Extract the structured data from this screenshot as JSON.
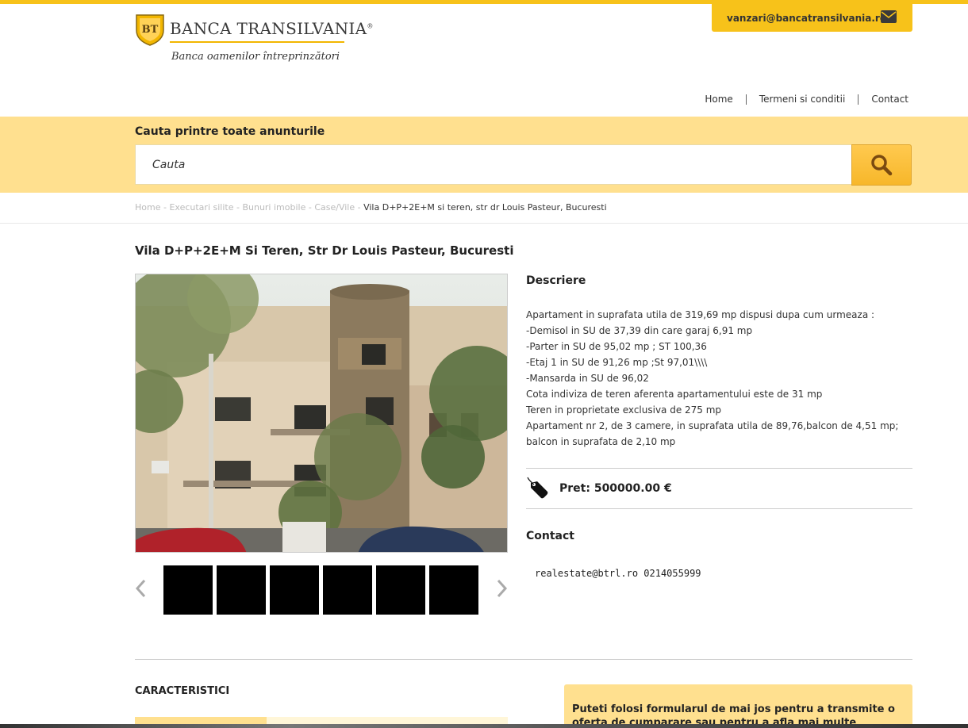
{
  "header": {
    "logo_initials": "BT",
    "bank_name": "BANCA TRANSILVANIA",
    "registered_mark": "®",
    "tagline": "Banca oamenilor întreprinzători",
    "email": "vanzari@bancatransilvania.ro"
  },
  "nav": {
    "items": [
      "Home",
      "Termeni si conditii",
      "Contact"
    ]
  },
  "search": {
    "title": "Cauta printre toate anunturile",
    "placeholder": "Cauta"
  },
  "breadcrumb": {
    "items": [
      "Home",
      "Executari silite",
      "Bunuri imobile",
      "Case/Vile"
    ],
    "separator": " - ",
    "current": "Vila D+P+2E+M si teren, str dr Louis Pasteur, Bucuresti"
  },
  "listing": {
    "title": "Vila D+P+2E+M Si Teren, Str Dr Louis Pasteur, Bucuresti",
    "description_heading": "Descriere",
    "description_lines": [
      "Apartament in suprafata utila de 319,69 mp dispusi dupa cum urmeaza :",
      "-Demisol in SU de 37,39 din care garaj 6,91 mp",
      "-Parter in SU de 95,02 mp ; ST 100,36",
      "-Etaj 1 in SU de 91,26 mp ;St 97,01\\\\\\\\",
      "-Mansarda in SU de 96,02",
      "Cota indiviza de teren aferenta apartamentului este de 31 mp",
      "Teren in proprietate exclusiva de 275 mp",
      "Apartament nr 2, de 3 camere, in suprafata utila de 89,76,balcon de 4,51 mp; balcon in suprafata de 2,10 mp"
    ],
    "price": "Pret: 500000.00 €",
    "contact_heading": "Contact",
    "contact_text": "realestate@btrl.ro 0214055999",
    "thumbnail_count": 6
  },
  "sections": {
    "characteristics_heading": "CARACTERISTICI",
    "offer_text": "Puteti folosi formularul de mai jos pentru a transmite o oferta de cumparare sau pentru a afla mai multe informatii"
  },
  "colors": {
    "accent": "#f7c21a",
    "band": "#ffe08f",
    "search_button": "#f7b72a"
  }
}
